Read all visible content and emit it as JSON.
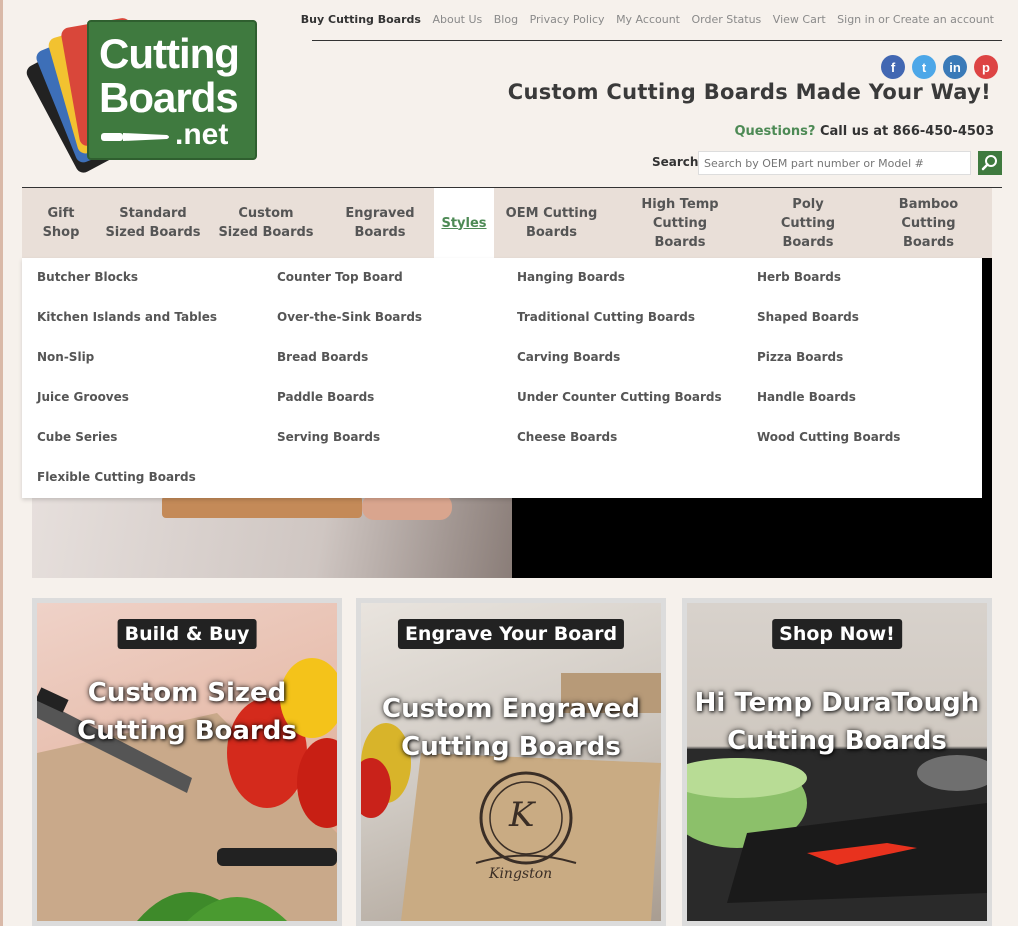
{
  "logo": {
    "line1": "Cutting",
    "line2": "Boards",
    "line3": ".net"
  },
  "top_links": [
    "Buy Cutting Boards",
    "About Us",
    "Blog",
    "Privacy Policy",
    "My Account",
    "Order Status",
    "View Cart",
    "Sign in or Create an account"
  ],
  "social": {
    "facebook": "f",
    "twitter": "t",
    "linkedin": "in",
    "pinterest": "p"
  },
  "tagline": "Custom Cutting Boards Made Your Way!",
  "contact": {
    "questions": "Questions?",
    "call": "Call us at 866-450-4503"
  },
  "search": {
    "label": "Search",
    "placeholder": "Search by OEM part number or Model #"
  },
  "nav": [
    {
      "label": "Gift Shop"
    },
    {
      "label": "Standard Sized Boards"
    },
    {
      "label": "Custom Sized Boards"
    },
    {
      "label": "Engraved Boards"
    },
    {
      "label": "Styles",
      "active": true
    },
    {
      "label": "OEM Cutting Boards"
    },
    {
      "label": "High Temp Cutting Boards"
    },
    {
      "label": "Poly Cutting Boards"
    },
    {
      "label": "Bamboo Cutting Boards"
    }
  ],
  "styles_menu": {
    "col1": [
      "Butcher Blocks",
      "Kitchen Islands and Tables",
      "Non-Slip",
      "Juice Grooves",
      "Cube Series",
      "Flexible Cutting Boards"
    ],
    "col2": [
      "Counter Top Board",
      "Over-the-Sink Boards",
      "Bread Boards",
      "Paddle Boards",
      "Serving Boards"
    ],
    "col3": [
      "Hanging Boards",
      "Traditional Cutting Boards",
      "Carving Boards",
      "Under Counter Cutting Boards",
      "Cheese Boards"
    ],
    "col4": [
      "Herb Boards",
      "Shaped Boards",
      "Pizza Boards",
      "Handle Boards",
      "Wood Cutting Boards"
    ]
  },
  "cards": [
    {
      "badge": "Build & Buy",
      "title_1": "Custom Sized",
      "title_2": "Cutting Boards"
    },
    {
      "badge": "Engrave Your Board",
      "title_1": "Custom Engraved",
      "title_2": "Cutting Boards",
      "engraving": "Kingston",
      "monogram": "K"
    },
    {
      "badge": "Shop Now!",
      "title_1": "Hi Temp DuraTough",
      "title_2": "Cutting Boards"
    }
  ],
  "colors": {
    "brand_green": "#3f7a3f",
    "accent_green": "#4d8a55",
    "nav_bg": "#e9dfd8",
    "page_bg": "#f6f1ec"
  }
}
